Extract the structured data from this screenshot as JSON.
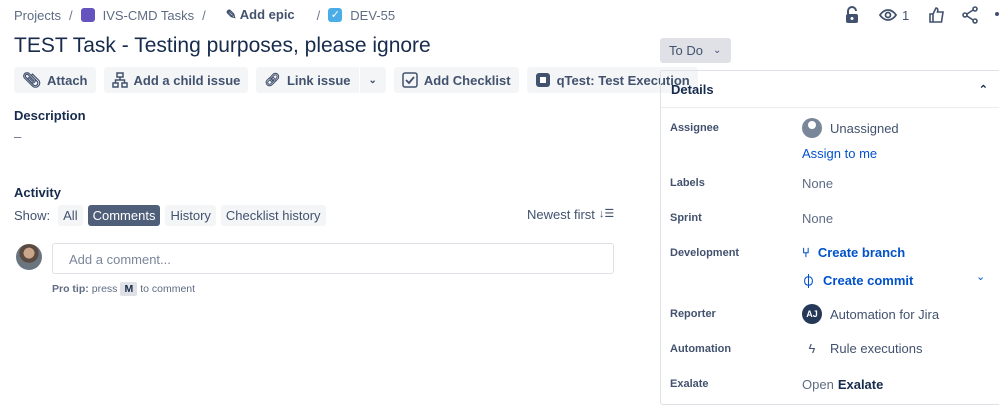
{
  "breadcrumb": {
    "projects": "Projects",
    "project": "IVS-CMD Tasks",
    "epic": "Add epic",
    "issue_key": "DEV-55"
  },
  "toolbar": {
    "watchers": "1"
  },
  "issue": {
    "title": "TEST Task - Testing purposes, please ignore"
  },
  "actions": {
    "attach": "Attach",
    "child": "Add a child issue",
    "link": "Link issue",
    "checklist": "Add Checklist",
    "qtest": "qTest: Test Execution"
  },
  "description": {
    "heading": "Description",
    "value": "–"
  },
  "activity": {
    "heading": "Activity",
    "show": "Show:",
    "filters": [
      "All",
      "Comments",
      "History",
      "Checklist history"
    ],
    "sort": "Newest first",
    "comment_placeholder": "Add a comment...",
    "protip_bold": "Pro tip:",
    "protip_press": "press",
    "protip_key": "M",
    "protip_rest": "to comment"
  },
  "status": {
    "label": "To Do"
  },
  "details": {
    "heading": "Details",
    "assignee_label": "Assignee",
    "assignee": "Unassigned",
    "assign_to_me": "Assign to me",
    "labels_label": "Labels",
    "labels": "None",
    "sprint_label": "Sprint",
    "sprint": "None",
    "development_label": "Development",
    "create_branch": "Create branch",
    "create_commit": "Create commit",
    "reporter_label": "Reporter",
    "reporter_initials": "AJ",
    "reporter": "Automation for Jira",
    "automation_label": "Automation",
    "automation": "Rule executions",
    "exalate_label": "Exalate",
    "exalate_open": "Open",
    "exalate_name": "Exalate"
  },
  "colors": {
    "link": "#0052cc",
    "selected_chip": "#505f79",
    "text": "#172b4d"
  }
}
